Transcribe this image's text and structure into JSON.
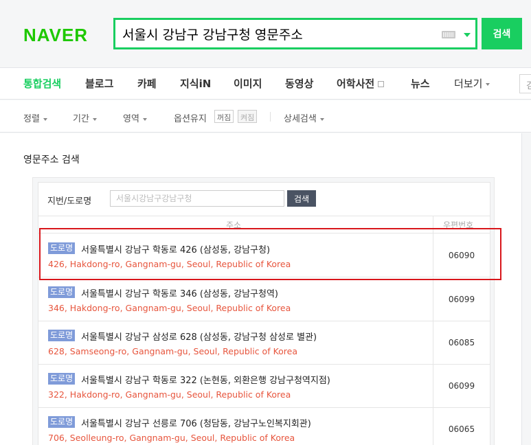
{
  "header": {
    "logo": "NAVER",
    "search_value": "서울시 강남구 강남구청 영문주소",
    "search_button": "검색",
    "accent": "#19ce60"
  },
  "nav": {
    "items": [
      "통합검색",
      "블로그",
      "카페",
      "지식iN",
      "이미지",
      "동영상",
      "어학사전",
      "뉴스",
      "더보기"
    ],
    "right_box": "검"
  },
  "options": {
    "items": [
      "정렬",
      "기간",
      "영역",
      "옵션유지",
      "상세검색"
    ],
    "toggle_on": "꺼짐",
    "toggle_off": "켜짐"
  },
  "content": {
    "section_title": "영문주소 검색",
    "form": {
      "label": "지번/도로명",
      "placeholder": "서울시강남구강남구청",
      "button": "검색"
    },
    "table": {
      "headers": [
        "주소",
        "우편번호"
      ],
      "rows": [
        {
          "badge": "도로명",
          "korean": "서울특별시 강남구 학동로 426 (삼성동, 강남구청)",
          "english": "426, Hakdong-ro, Gangnam-gu, Seoul, Republic of Korea",
          "zip": "06090"
        },
        {
          "badge": "도로명",
          "korean": "서울특별시 강남구 학동로 346 (삼성동, 강남구청역)",
          "english": "346, Hakdong-ro, Gangnam-gu, Seoul, Republic of Korea",
          "zip": "06099"
        },
        {
          "badge": "도로명",
          "korean": "서울특별시 강남구 삼성로 628 (삼성동, 강남구청 삼성로 별관)",
          "english": "628, Samseong-ro, Gangnam-gu, Seoul, Republic of Korea",
          "zip": "06085"
        },
        {
          "badge": "도로명",
          "korean": "서울특별시 강남구 학동로 322 (논현동, 외환은행 강남구청역지점)",
          "english": "322, Hakdong-ro, Gangnam-gu, Seoul, Republic of Korea",
          "zip": "06099"
        },
        {
          "badge": "도로명",
          "korean": "서울특별시 강남구 선릉로 706 (청담동, 강남구노인복지회관)",
          "english": "706, Seolleung-ro, Gangnam-gu, Seoul, Republic of Korea",
          "zip": "06065"
        }
      ]
    }
  }
}
